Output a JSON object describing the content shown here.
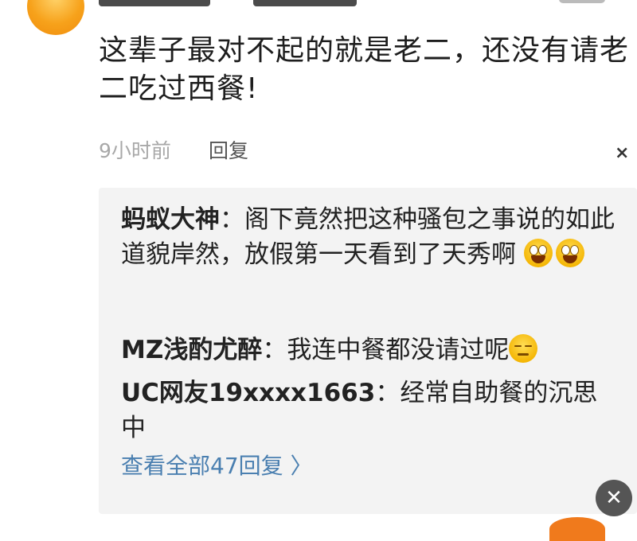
{
  "comment": {
    "text": "这辈子最对不起的就是老二，还没有请老二吃过西餐!",
    "time": "9小时前",
    "reply_label": "回复",
    "dismiss_glyph": "×"
  },
  "replies": [
    {
      "author": "蚂蚁大神",
      "sep": "：",
      "text": "阁下竟然把这种骚包之事说的如此道貌岸然，放假第一天看到了天秀啊",
      "emojis": [
        "grinning-face-icon",
        "grinning-face-icon"
      ]
    },
    {
      "author": "MZ浅酌尤醉",
      "sep": "：",
      "text": "我连中餐都没请过呢",
      "emojis": [
        "sleepy-face-icon"
      ]
    },
    {
      "author": "UC网友19xxxx1663",
      "sep": "：",
      "text": "经常自助餐的沉思中",
      "emojis": []
    }
  ],
  "view_all_label": "查看全部47回复",
  "view_all_chevron": "〉",
  "overlay_close_glyph": "✕",
  "colors": {
    "link": "#4a7fb0",
    "meta": "#a8a8a8",
    "reply_bg": "#f3f3f3",
    "avatar": "#f7a21b"
  }
}
